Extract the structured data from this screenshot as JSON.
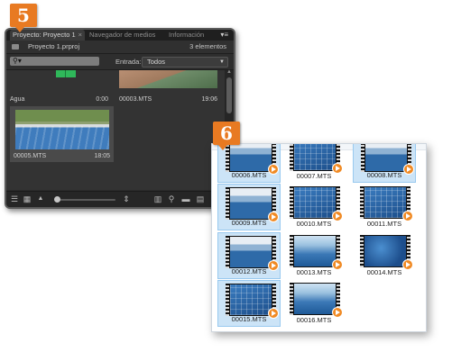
{
  "steps": {
    "first": "5",
    "second": "6"
  },
  "premiere": {
    "tabs": {
      "project": "Proyecto: Proyecto 1",
      "media_browser": "Navegador de medios",
      "info": "Información"
    },
    "panel_menu": "▾≡",
    "project_file": "Proyecto 1.prproj",
    "item_count": "3 elementos",
    "search_glyph": "⚲▾",
    "entrada_label": "Entrada:",
    "entrada_value": "Todos",
    "clips": [
      {
        "name": "Agua",
        "duration": "0:00"
      },
      {
        "name": "00003.MTS",
        "duration": "19:06"
      },
      {
        "name": "00005.MTS",
        "duration": "18:05"
      }
    ]
  },
  "explorer": {
    "files": [
      {
        "name": "00006.MTS",
        "selected": true
      },
      {
        "name": "00007.MTS",
        "selected": false
      },
      {
        "name": "00008.MTS",
        "selected": true
      },
      {
        "name": "00009.MTS",
        "selected": true
      },
      {
        "name": "00010.MTS",
        "selected": false
      },
      {
        "name": "00011.MTS",
        "selected": false
      },
      {
        "name": "00012.MTS",
        "selected": true
      },
      {
        "name": "00013.MTS",
        "selected": false
      },
      {
        "name": "00014.MTS",
        "selected": false
      },
      {
        "name": "00015.MTS",
        "selected": true
      },
      {
        "name": "00016.MTS",
        "selected": false
      }
    ]
  },
  "colors": {
    "accent": "#e87a22",
    "panel_bg": "#2b2b2b",
    "selection": "#cce4f7"
  }
}
